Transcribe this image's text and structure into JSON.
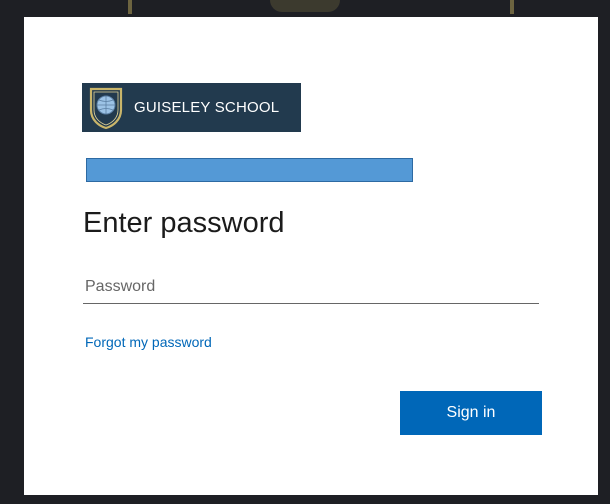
{
  "branding": {
    "school_name": "GUISELEY SCHOOL",
    "logo_background": "#223a4e",
    "crest_icon": "school-crest-icon"
  },
  "account": {
    "identity_bar_color": "#5499d6"
  },
  "heading": "Enter password",
  "password_field": {
    "placeholder": "Password",
    "value": ""
  },
  "forgot_password_link": "Forgot my password",
  "sign_in_button": "Sign in",
  "colors": {
    "accent": "#0067b8",
    "background": "#1e1f24",
    "card": "#ffffff"
  }
}
